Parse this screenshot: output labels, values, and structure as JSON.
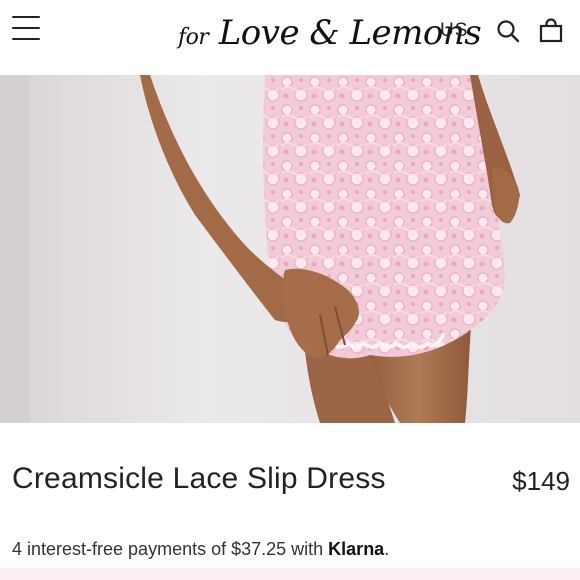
{
  "header": {
    "logo_text_small": "for",
    "logo_text_main": "Love & Lemons",
    "region": "US",
    "icons": [
      "menu-icon",
      "search-icon",
      "bag-icon"
    ]
  },
  "product": {
    "title": "Creamsicle Lace Slip Dress",
    "price": "$149",
    "installments": {
      "prefix": "4 interest-free payments of $37.25 with ",
      "provider": "Klarna",
      "suffix": "."
    }
  },
  "colors": {
    "lace": "#f2c9d6",
    "skin": "#a36a48",
    "wall": "#e6e2e3"
  }
}
